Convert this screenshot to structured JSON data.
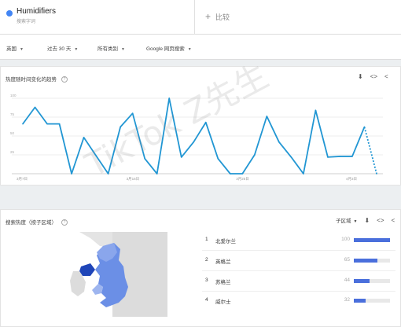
{
  "term": {
    "name": "Humidifiers",
    "subtitle": "搜索字词",
    "color": "#4285f4"
  },
  "compare": {
    "icon": "plus-icon",
    "label": "比较"
  },
  "filters": {
    "region": "英国",
    "period": "过去 30 天",
    "category": "所有类别",
    "search_type": "Google 网页搜索"
  },
  "interest_over_time": {
    "title": "热度随时间变化的趋势",
    "icons": [
      "download-icon",
      "embed-icon",
      "share-icon"
    ]
  },
  "chart_data": {
    "type": "line",
    "x_tick_labels": [
      "3月7日",
      "3月16日",
      "3月25日",
      "4月3日"
    ],
    "y_ticks": [
      25,
      50,
      75,
      100
    ],
    "ylim": [
      0,
      100
    ],
    "grid": true,
    "series": [
      {
        "color": "#2196d3",
        "values": [
          66,
          88,
          66,
          66,
          0,
          48,
          24,
          0,
          62,
          80,
          20,
          0,
          100,
          22,
          42,
          68,
          20,
          0,
          0,
          25,
          76,
          42,
          22,
          0,
          84,
          22,
          23,
          23,
          62,
          0
        ],
        "partial_from_index": 28
      }
    ]
  },
  "region_interest": {
    "title": "搜索热度（按子区域）",
    "filter_label": "子区域",
    "icons": [
      "download-icon",
      "embed-icon",
      "share-icon"
    ],
    "rows": [
      {
        "rank": "1",
        "name": "北爱尔兰",
        "value": "100",
        "level": 100
      },
      {
        "rank": "2",
        "name": "英格兰",
        "value": "65",
        "level": 65
      },
      {
        "rank": "3",
        "name": "苏格兰",
        "value": "44",
        "level": 44
      },
      {
        "rank": "4",
        "name": "威尔士",
        "value": "32",
        "level": 32
      }
    ]
  },
  "watermark": "TikTok Z先生",
  "colors": {
    "accent": "#4285f4",
    "line": "#2196d3",
    "bar": "#4a6fdc"
  }
}
